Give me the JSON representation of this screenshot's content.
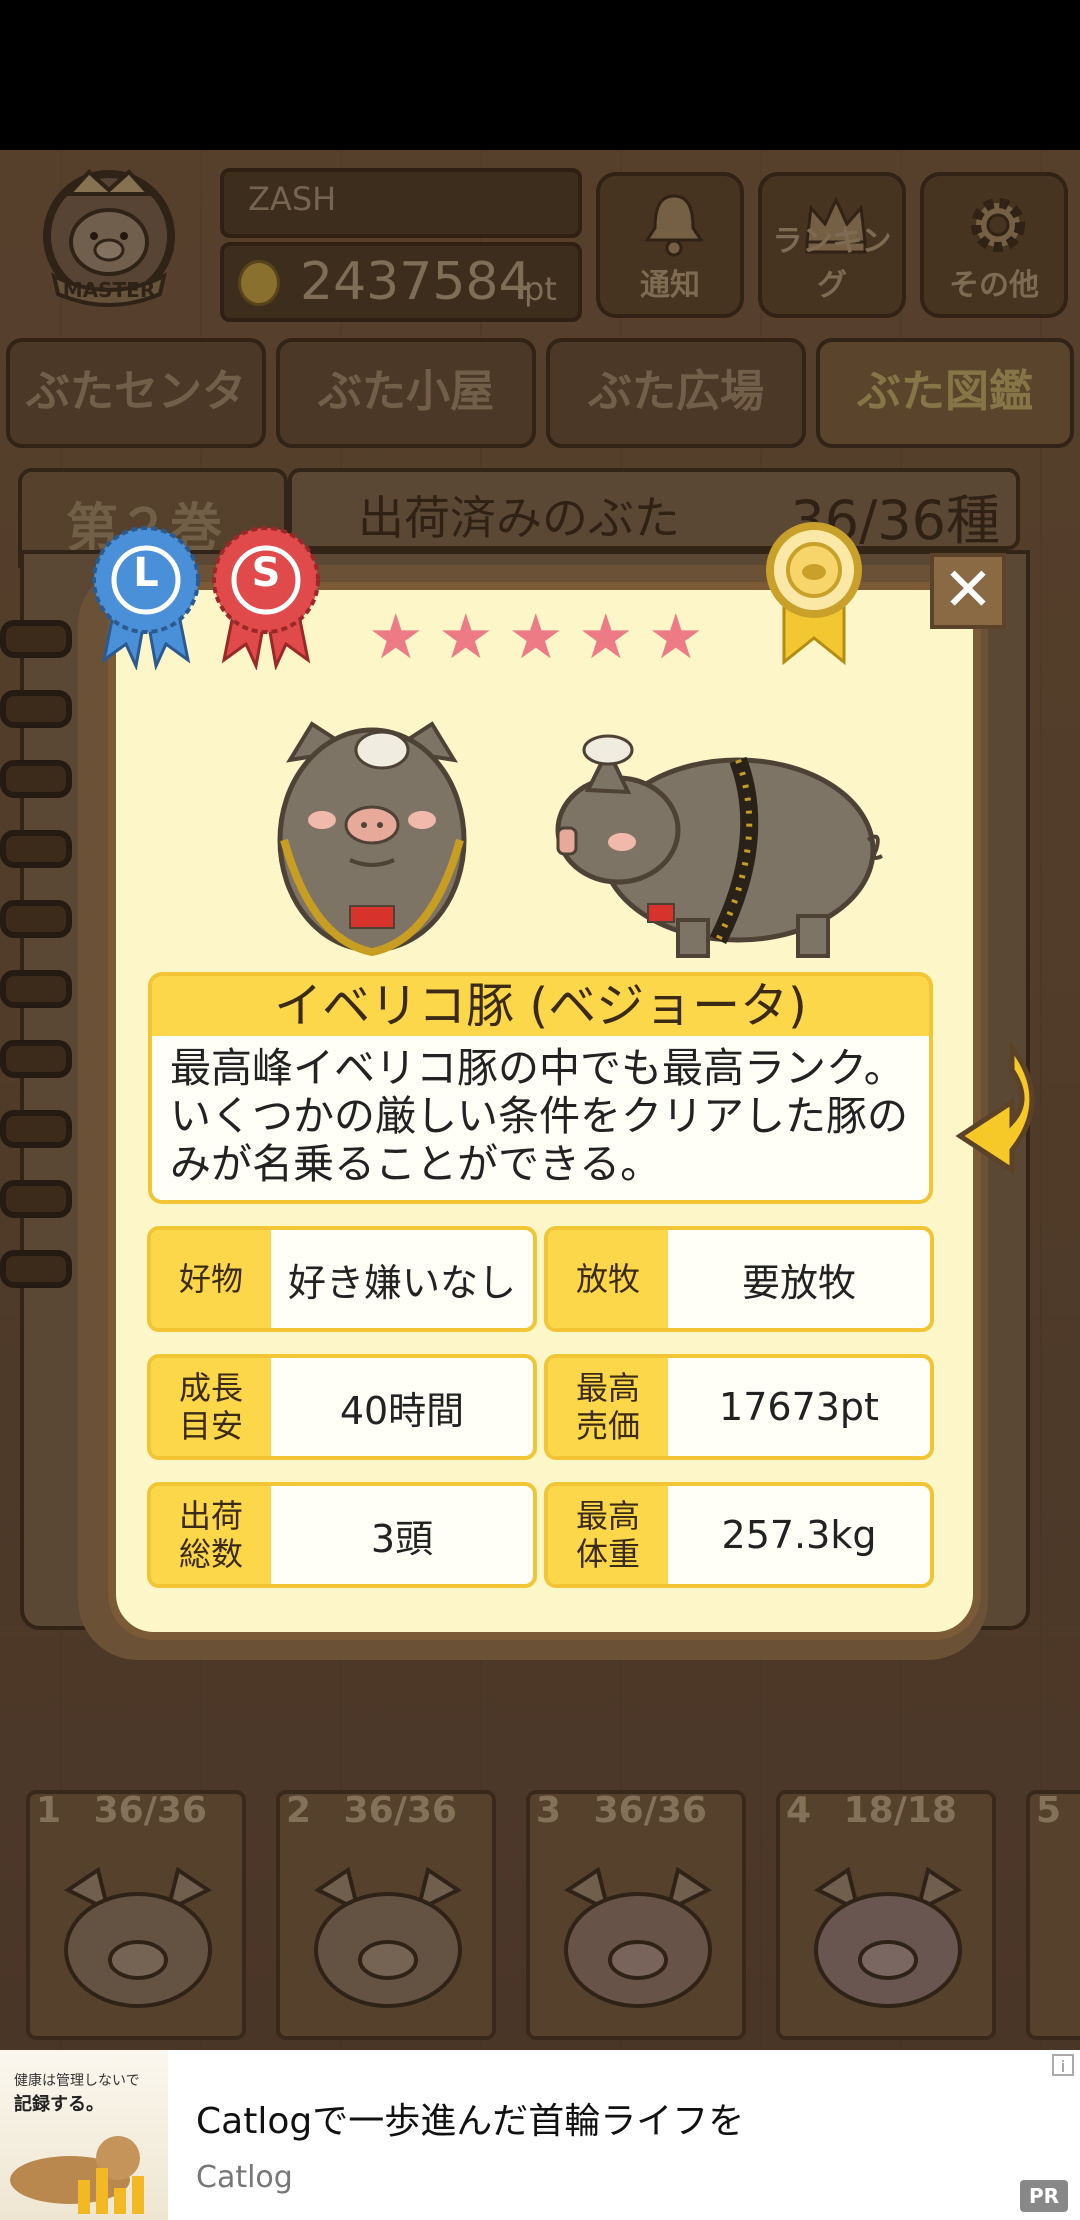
{
  "header": {
    "badge_text": "MASTER",
    "player_name": "ZASH",
    "points_value": "2437584",
    "points_unit": "pt",
    "buttons": [
      {
        "label": "通知",
        "icon": "bell-icon"
      },
      {
        "label": "ランキング",
        "icon": "crown-icon"
      },
      {
        "label": "その他",
        "icon": "gear-icon"
      }
    ]
  },
  "nav_tabs": [
    "ぶたセンター",
    "ぶた小屋",
    "ぶた広場",
    "ぶた図鑑"
  ],
  "book_header": {
    "volume": "第２巻",
    "title": "出荷済みのぶた",
    "count": "36/36種"
  },
  "card": {
    "ribbons": [
      "L",
      "S"
    ],
    "rating_stars": 5,
    "close_label": "✕",
    "name": "イベリコ豚 (ベジョータ)",
    "description": [
      "最高峰イベリコ豚の中でも最高ランク。",
      "いくつかの厳しい条件をクリアした豚の",
      "みが名乗ることができる。"
    ],
    "stats": [
      {
        "key": [
          "好物"
        ],
        "value": "好き嫌いなし"
      },
      {
        "key": [
          "放牧"
        ],
        "value": "要放牧"
      },
      {
        "key": [
          "成長",
          "目安"
        ],
        "value": "40時間"
      },
      {
        "key": [
          "最高",
          "売価"
        ],
        "value": "17673pt"
      },
      {
        "key": [
          "出荷",
          "総数"
        ],
        "value": "3頭"
      },
      {
        "key": [
          "最高",
          "体重"
        ],
        "value": "257.3kg"
      }
    ]
  },
  "books": [
    {
      "num": "1",
      "count": "36/36"
    },
    {
      "num": "2",
      "count": "36/36"
    },
    {
      "num": "3",
      "count": "36/36"
    },
    {
      "num": "4",
      "count": "18/18"
    },
    {
      "num": "5",
      "count": ""
    }
  ],
  "ad": {
    "image_text": [
      "健康は管理しないで",
      "記録する。"
    ],
    "headline": "Catlogで一歩進んだ首輪ライフを",
    "advertiser": "Catlog",
    "badge": "PR",
    "info": "i"
  },
  "colors": {
    "card_bg": "#fcf6c8",
    "label_yellow": "#fcd74a",
    "star_pink": "#ec7b86",
    "wood": "#5b4330"
  }
}
